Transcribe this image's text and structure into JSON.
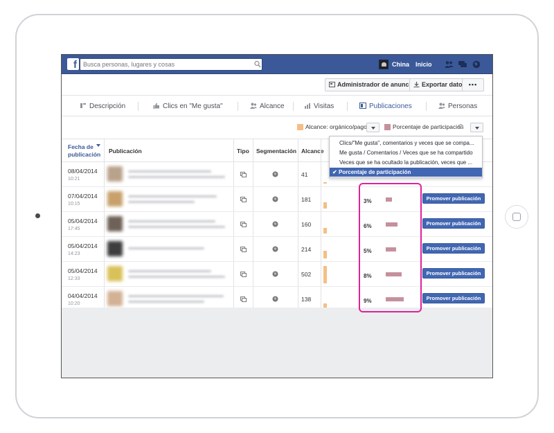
{
  "topbar": {
    "logo": "f",
    "search_placeholder": "Busca personas, lugares y cosas",
    "user_name": "China",
    "home": "Inicio"
  },
  "actions": {
    "ads_manager": "Administrador de anuncios",
    "export": "Exportar datos",
    "more": "•••"
  },
  "tabs": [
    {
      "label": "Descripción",
      "icon": "overview-icon"
    },
    {
      "label": "Clics en \"Me gusta\"",
      "icon": "thumbs-up-icon"
    },
    {
      "label": "Alcance",
      "icon": "people-icon"
    },
    {
      "label": "Visitas",
      "icon": "bar-chart-icon"
    },
    {
      "label": "Publicaciones",
      "icon": "posts-icon",
      "active": true
    },
    {
      "label": "Personas",
      "icon": "people-icon"
    }
  ],
  "legend": {
    "reach": "Alcance: orgánico/pago",
    "engagement": "Porcentaje de participación",
    "reach_color": "#f6be85",
    "engagement_color": "#c6909d"
  },
  "table": {
    "headers": {
      "date": "Fecha de publicación",
      "post": "Publicación",
      "type": "Tipo",
      "targeting": "Segmentación",
      "reach": "Alcance"
    },
    "rows": [
      {
        "date": "08/04/2014",
        "time": "10:21",
        "reach": "41",
        "reach_fraction": 0.08,
        "pct": "",
        "pct_fraction": 0
      },
      {
        "date": "07/04/2014",
        "time": "10:15",
        "reach": "181",
        "reach_fraction": 0.36,
        "pct": "3%",
        "pct_fraction": 0.33
      },
      {
        "date": "05/04/2014",
        "time": "17:45",
        "reach": "160",
        "reach_fraction": 0.32,
        "pct": "6%",
        "pct_fraction": 0.67
      },
      {
        "date": "05/04/2014",
        "time": "14:23",
        "reach": "214",
        "reach_fraction": 0.43,
        "pct": "5%",
        "pct_fraction": 0.56
      },
      {
        "date": "05/04/2014",
        "time": "12:33",
        "reach": "502",
        "reach_fraction": 1.0,
        "pct": "8%",
        "pct_fraction": 0.89
      },
      {
        "date": "04/04/2014",
        "time": "10:20",
        "reach": "138",
        "reach_fraction": 0.27,
        "pct": "9%",
        "pct_fraction": 1.0
      }
    ],
    "promote_label": "Promover publicación"
  },
  "dropdown": {
    "items": [
      "Clics/\"Me gusta\", comentarios y veces que se compa...",
      "Me gusta / Comentarios / Veces que se ha compartido",
      "Veces que se ha ocultado la publicación, veces que ...",
      "Porcentaje de participación"
    ],
    "selected_index": 3,
    "check": "✔"
  }
}
